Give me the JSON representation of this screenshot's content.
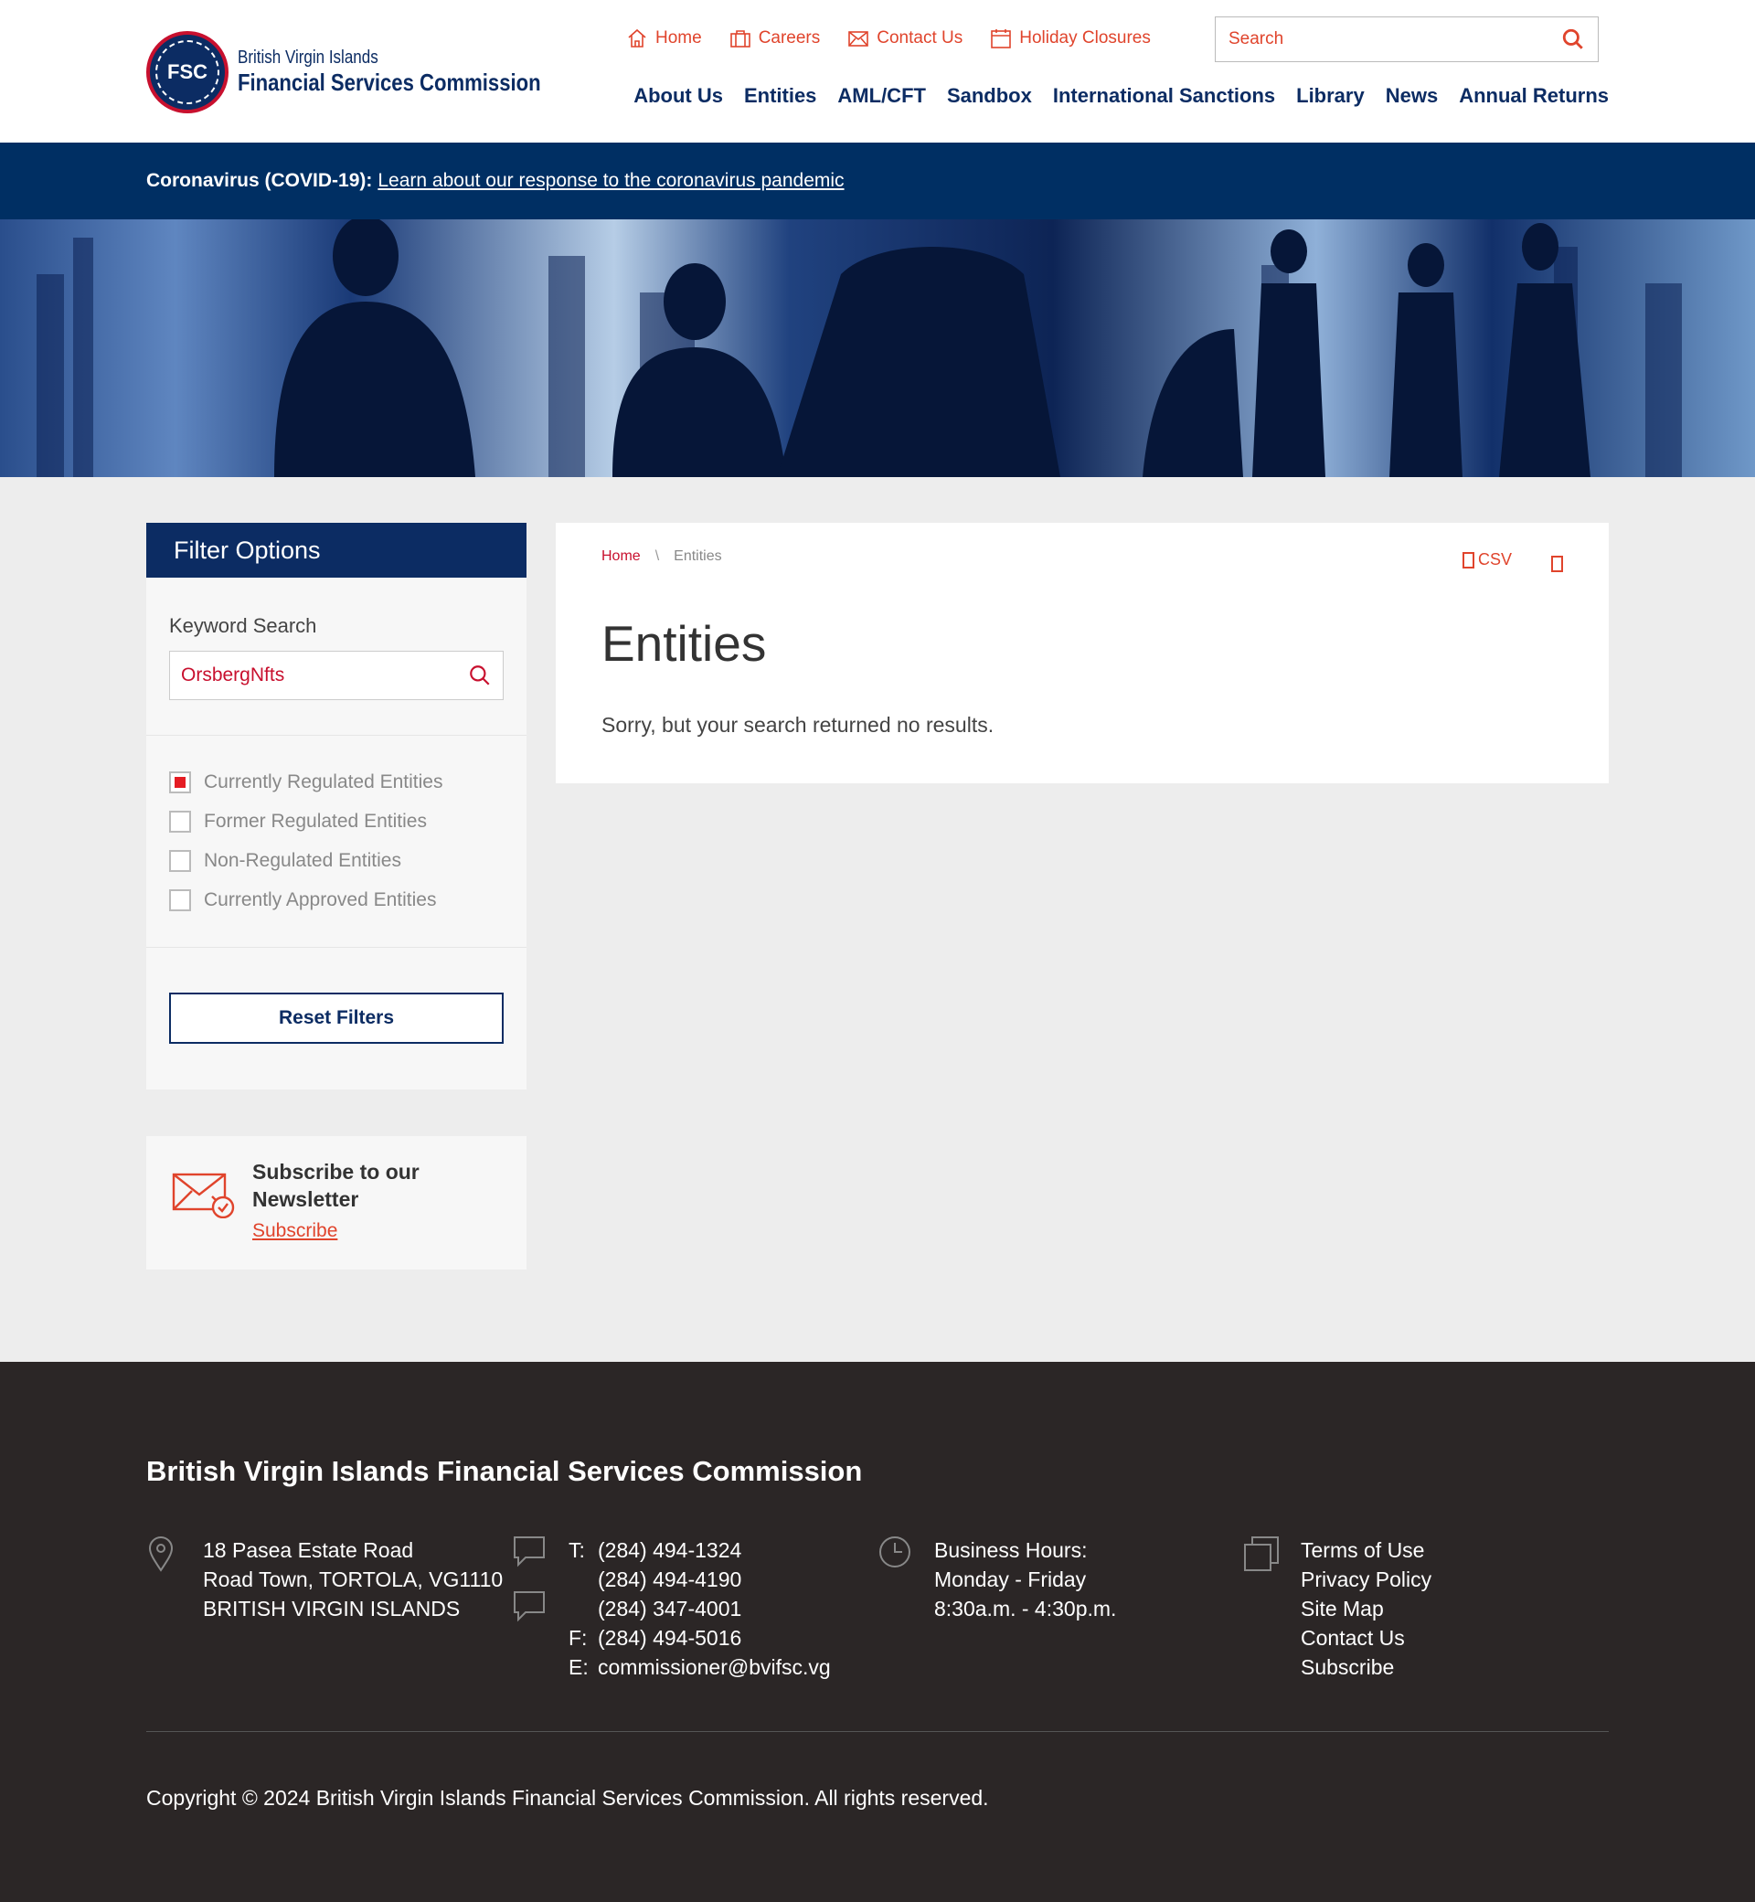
{
  "header": {
    "logo": {
      "seal_text": "FSC",
      "line1": "British Virgin Islands",
      "line2": "Financial Services Commission"
    },
    "utility_links": [
      {
        "label": "Home",
        "icon": "home-icon"
      },
      {
        "label": "Careers",
        "icon": "briefcase-icon"
      },
      {
        "label": "Contact Us",
        "icon": "envelope-icon"
      },
      {
        "label": "Holiday Closures",
        "icon": "calendar-icon"
      }
    ],
    "search": {
      "placeholder": "Search"
    },
    "main_nav": [
      "About Us",
      "Entities",
      "AML/CFT",
      "Sandbox",
      "International Sanctions",
      "Library",
      "News",
      "Annual Returns"
    ]
  },
  "banner": {
    "label": "Coronavirus (COVID-19):",
    "link_text": "Learn about our response to the coronavirus pandemic"
  },
  "filter": {
    "title": "Filter Options",
    "keyword_label": "Keyword Search",
    "keyword_value": "OrsbergNfts",
    "checkboxes": [
      {
        "label": "Currently Regulated Entities",
        "checked": true
      },
      {
        "label": "Former Regulated Entities",
        "checked": false
      },
      {
        "label": "Non-Regulated Entities",
        "checked": false
      },
      {
        "label": "Currently Approved Entities",
        "checked": false
      }
    ],
    "reset_label": "Reset Filters"
  },
  "newsletter": {
    "title": "Subscribe to our Newsletter",
    "link": "Subscribe"
  },
  "content": {
    "breadcrumb": {
      "home": "Home",
      "separator": "\\",
      "current": "Entities"
    },
    "csv_label": "CSV",
    "title": "Entities",
    "message": "Sorry, but your search returned no results."
  },
  "footer": {
    "title": "British Virgin Islands Financial Services Commission",
    "address": [
      "18 Pasea Estate Road",
      "Road Town, TORTOLA, VG1110",
      "BRITISH VIRGIN ISLANDS"
    ],
    "contacts": [
      {
        "key": "T:",
        "value": "(284) 494-1324"
      },
      {
        "key": "",
        "value": "(284) 494-4190"
      },
      {
        "key": "",
        "value": "(284) 347-4001"
      },
      {
        "key": "F:",
        "value": "(284) 494-5016"
      },
      {
        "key": "E:",
        "value": "commissioner@bvifsc.vg"
      }
    ],
    "hours": [
      "Business Hours:",
      "Monday - Friday",
      "8:30a.m. - 4:30p.m."
    ],
    "links": [
      "Terms of Use",
      "Privacy Policy",
      "Site Map",
      "Contact Us",
      "Subscribe"
    ],
    "copyright": "Copyright © 2024 British Virgin Islands Financial Services Commission. All rights reserved."
  },
  "colors": {
    "navy": "#0c2c63",
    "banner": "#002f63",
    "accent": "#e0442c",
    "footer": "#2b2626"
  }
}
